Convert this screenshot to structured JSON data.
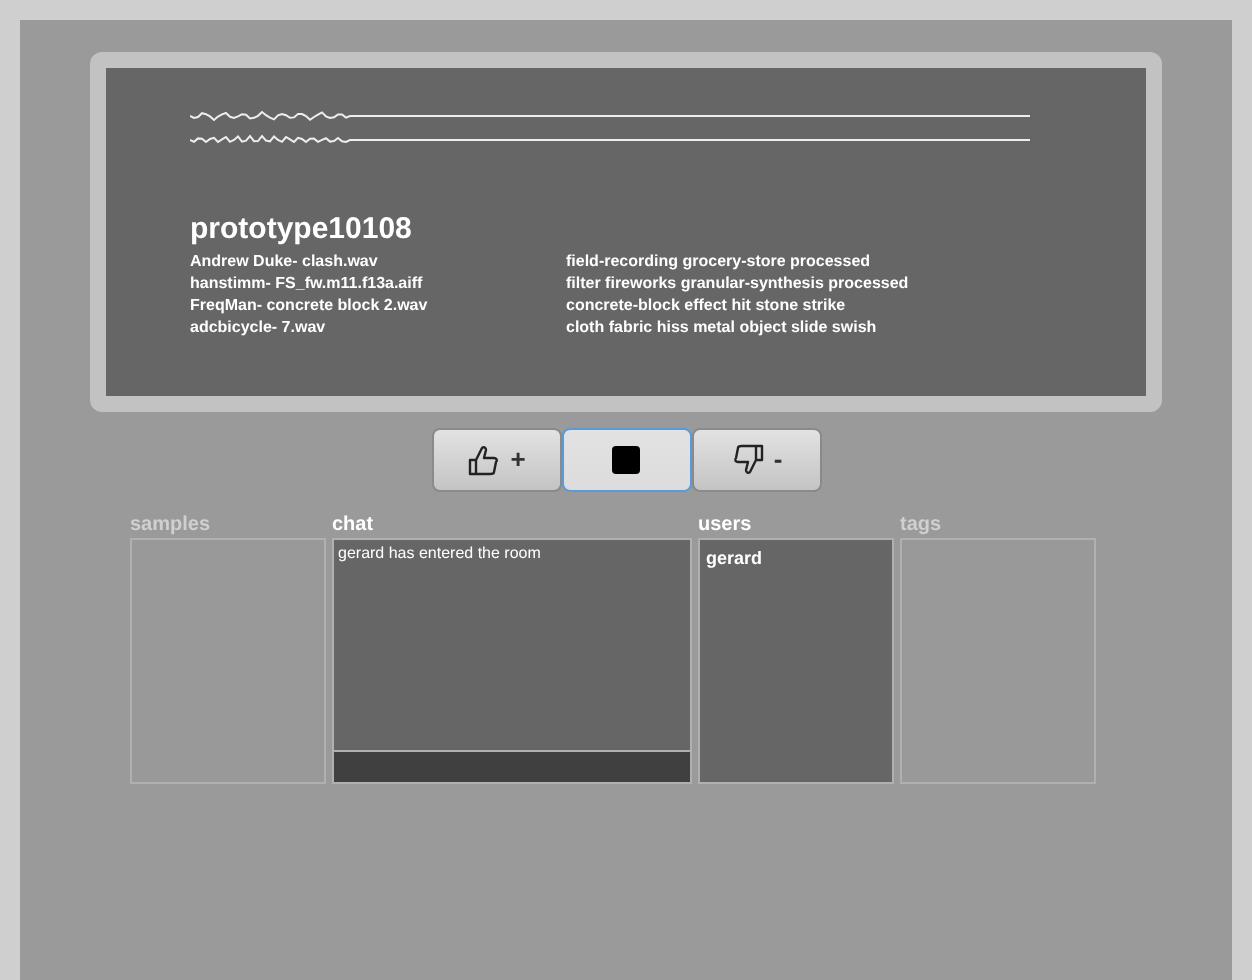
{
  "player": {
    "title": "prototype10108",
    "samples": [
      {
        "source": "Andrew Duke- clash.wav",
        "tags": "field-recording grocery-store processed"
      },
      {
        "source": "hanstimm- FS_fw.m11.f13a.aiff",
        "tags": "filter fireworks granular-synthesis processed"
      },
      {
        "source": "FreqMan- concrete block 2.wav",
        "tags": "concrete-block effect hit stone strike"
      },
      {
        "source": "adcbicycle- 7.wav",
        "tags": "cloth fabric hiss metal object slide swish"
      }
    ]
  },
  "controls": [
    {
      "kind": "like",
      "label": "+",
      "selected": false
    },
    {
      "kind": "stop",
      "selected": true
    },
    {
      "kind": "dislike",
      "label": "-",
      "selected": false
    }
  ],
  "panels": [
    {
      "kind": "list",
      "label": "samples",
      "enabled": false
    },
    {
      "kind": "chat",
      "label": "chat",
      "enabled": true,
      "messages": [
        "gerard has entered the room"
      ]
    },
    {
      "kind": "list",
      "label": "users",
      "enabled": true,
      "items": [
        "gerard"
      ]
    },
    {
      "kind": "list",
      "label": "tags",
      "enabled": false
    }
  ]
}
